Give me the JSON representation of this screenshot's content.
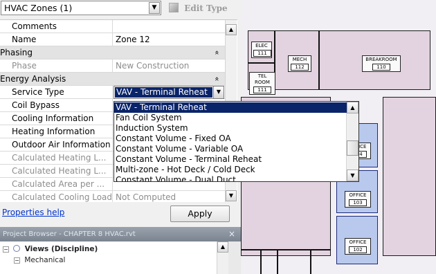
{
  "properties": {
    "type_selector": "HVAC Zones (1)",
    "edit_type_label": "Edit Type",
    "rows": [
      {
        "kind": "param",
        "label": "Comments",
        "value": ""
      },
      {
        "kind": "param",
        "label": "Name",
        "value": "Zone 12"
      },
      {
        "kind": "group",
        "label": "Phasing",
        "toggle": "»"
      },
      {
        "kind": "param",
        "label": "Phase",
        "value": "New Construction",
        "disabled": true
      },
      {
        "kind": "group",
        "label": "Energy Analysis",
        "toggle": "»"
      },
      {
        "kind": "select",
        "label": "Service Type",
        "value": "VAV - Terminal Reheat"
      },
      {
        "kind": "param",
        "label": "Coil Bypass",
        "value": ""
      },
      {
        "kind": "param",
        "label": "Cooling Information",
        "value": ""
      },
      {
        "kind": "param",
        "label": "Heating Information",
        "value": ""
      },
      {
        "kind": "param",
        "label": "Outdoor Air Information",
        "value": ""
      },
      {
        "kind": "param",
        "label": "Calculated Heating L...",
        "value": "",
        "disabled": true
      },
      {
        "kind": "param",
        "label": "Calculated Heating L...",
        "value": "",
        "disabled": true
      },
      {
        "kind": "param",
        "label": "Calculated Area per ...",
        "value": "",
        "disabled": true
      },
      {
        "kind": "param",
        "label": "Calculated Cooling Load",
        "value": "Not Computed",
        "disabled": true
      }
    ],
    "help_link": "Properties help",
    "apply_label": "Apply"
  },
  "service_type_dropdown": {
    "options": [
      "VAV - Terminal Reheat",
      "Fan Coil System",
      "Induction System",
      "Constant Volume - Fixed OA",
      "Constant Volume - Variable OA",
      "Constant Volume - Terminal Reheat",
      "Multi-zone - Hot Deck / Cold Deck",
      "Constant Volume - Dual Duct"
    ],
    "selected": "VAV - Terminal Reheat"
  },
  "project_browser": {
    "title": "Project Browser - CHAPTER 8 HVAC.rvt",
    "close_glyph": "×",
    "items": [
      {
        "label": "Views (Discipline)",
        "toggle": "−"
      },
      {
        "label": "Mechanical",
        "toggle": "−"
      }
    ]
  },
  "canvas": {
    "rooms": [
      {
        "tag": "ELEC",
        "num": "111"
      },
      {
        "tag": "MECH",
        "num": "112"
      },
      {
        "tag": "BREAKROOM",
        "num": "110"
      },
      {
        "tag": "TEL ROOM",
        "num": "111"
      },
      {
        "tag": "OFFICE",
        "num": "104"
      },
      {
        "tag": "OFFICE",
        "num": "103"
      },
      {
        "tag": "OFFICE",
        "num": "102"
      }
    ]
  },
  "colors": {
    "selection": "#0a246a",
    "zone_highlight": "#b9c9ee",
    "room_fill": "#e3d3e0",
    "link": "#0033cc"
  }
}
